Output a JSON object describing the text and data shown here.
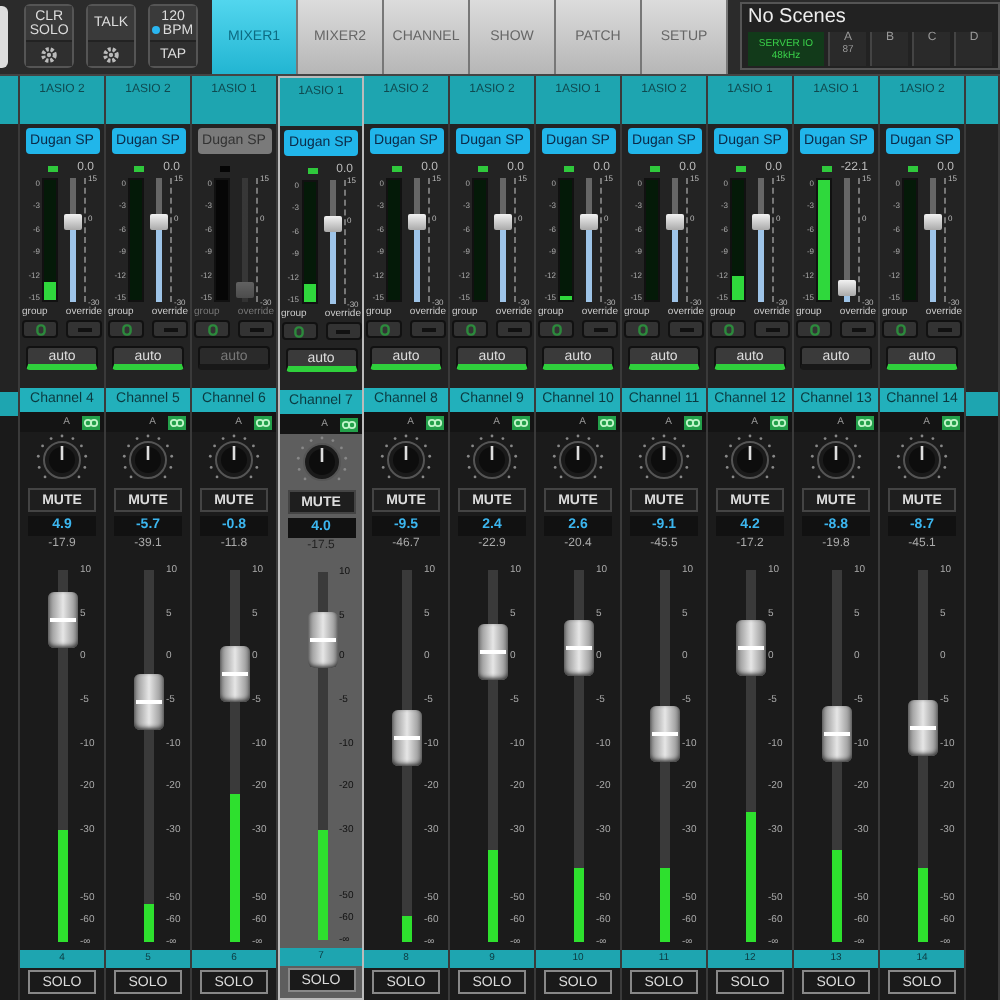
{
  "top_buttons": [
    {
      "kind": "gear",
      "label": "CLR SOLO"
    },
    {
      "kind": "gear",
      "label": "TALK"
    },
    {
      "kind": "tap",
      "tempo": "120",
      "unit": "BPM",
      "label": "TAP"
    }
  ],
  "tabs": [
    {
      "label": "MIXER1",
      "selected": true
    },
    {
      "label": "MIXER2",
      "selected": false
    },
    {
      "label": "CHANNEL",
      "selected": false
    },
    {
      "label": "SHOW",
      "selected": false
    },
    {
      "label": "PATCH",
      "selected": false
    },
    {
      "label": "SETUP",
      "selected": false
    }
  ],
  "scenes": {
    "title": "No Scenes",
    "server": "SERVER IO",
    "rate": "48kHz",
    "banks": [
      {
        "label": "A",
        "value": "87"
      },
      {
        "label": "B"
      },
      {
        "label": "C"
      },
      {
        "label": "D"
      }
    ]
  },
  "channels": [
    {
      "input": "1ASIO 2",
      "dugan": {
        "label": "Dugan SP",
        "enabled": true
      },
      "trim_reading": "0.0",
      "meter_scale": [
        "0",
        "-3",
        "-6",
        "-9",
        "-12",
        "-15"
      ],
      "meter": {
        "level": 0.15
      },
      "trim": {
        "level": 0.67
      },
      "trim_scale": [
        "15",
        "0",
        "-30"
      ],
      "group": "group",
      "override": "override",
      "auto": {
        "label": "auto",
        "on": true
      },
      "name": "Channel 4",
      "bus": "A",
      "mute": "MUTE",
      "gain": "4.9",
      "peak": "-17.9",
      "fader_scale": [
        "10",
        "5",
        "0",
        "-5",
        "-10",
        "-20",
        "-30",
        "-50",
        "-60",
        "-∞"
      ],
      "fader": {
        "level": 0.93
      },
      "fader_meter": {
        "level": 0.3
      },
      "number": "4",
      "solo": "SOLO",
      "selected": false
    },
    {
      "input": "1ASIO 2",
      "dugan": {
        "label": "Dugan SP",
        "enabled": true
      },
      "trim_reading": "0.0",
      "meter_scale": [
        "0",
        "-3",
        "-6",
        "-9",
        "-12",
        "-15"
      ],
      "trim": {
        "level": 0.67
      },
      "trim_scale": [
        "15",
        "0",
        "-30"
      ],
      "group": "group",
      "override": "override",
      "auto": {
        "label": "auto",
        "on": true
      },
      "name": "Channel 5",
      "bus": "A",
      "mute": "MUTE",
      "gain": "-5.7",
      "peak": "-39.1",
      "fader_scale": [
        "10",
        "5",
        "0",
        "-5",
        "-10",
        "-20",
        "-30",
        "-50",
        "-60",
        "-∞"
      ],
      "fader": {
        "level": 0.67
      },
      "fader_meter": {
        "level": 0.1
      },
      "number": "5",
      "solo": "SOLO",
      "selected": false
    },
    {
      "input": "1ASIO 1",
      "dugan": {
        "label": "Dugan SP",
        "enabled": false
      },
      "meter_scale": [
        "0",
        "-3",
        "-6",
        "-9",
        "-12",
        "-15"
      ],
      "trim": {
        "level": 0.03
      },
      "trim_scale": [
        "15",
        "0",
        "-30"
      ],
      "group": "group",
      "override": "override",
      "auto": {
        "label": "auto",
        "on": false
      },
      "name": "Channel 6",
      "bus": "A",
      "mute": "MUTE",
      "gain": "-0.8",
      "peak": "-11.8",
      "fader_scale": [
        "10",
        "5",
        "0",
        "-5",
        "-10",
        "-20",
        "-30",
        "-50",
        "-60",
        "-∞"
      ],
      "fader": {
        "level": 0.76
      },
      "fader_meter": {
        "level": 0.4
      },
      "number": "6",
      "solo": "SOLO",
      "selected": false
    },
    {
      "input": "1ASIO 1",
      "dugan": {
        "label": "Dugan SP",
        "enabled": true
      },
      "trim_reading": "0.0",
      "meter_scale": [
        "0",
        "-3",
        "-6",
        "-9",
        "-12",
        "-15"
      ],
      "meter": {
        "level": 0.15
      },
      "trim": {
        "level": 0.67
      },
      "trim_scale": [
        "15",
        "0",
        "-30"
      ],
      "group": "group",
      "override": "override",
      "auto": {
        "label": "auto",
        "on": true
      },
      "name": "Channel 7",
      "bus": "A",
      "mute": "MUTE",
      "gain": "4.0",
      "peak": "-17.5",
      "fader_scale": [
        "10",
        "5",
        "0",
        "-5",
        "-10",
        "-20",
        "-30",
        "-50",
        "-60",
        "-∞"
      ],
      "fader": {
        "level": 0.87
      },
      "fader_meter": {
        "level": 0.3
      },
      "number": "7",
      "solo": "SOLO",
      "selected": true
    },
    {
      "input": "1ASIO 2",
      "dugan": {
        "label": "Dugan SP",
        "enabled": true
      },
      "trim_reading": "0.0",
      "meter_scale": [
        "0",
        "-3",
        "-6",
        "-9",
        "-12",
        "-15"
      ],
      "trim": {
        "level": 0.67
      },
      "trim_scale": [
        "15",
        "0",
        "-30"
      ],
      "group": "group",
      "override": "override",
      "auto": {
        "label": "auto",
        "on": true
      },
      "name": "Channel 8",
      "bus": "A",
      "mute": "MUTE",
      "gain": "-9.5",
      "peak": "-46.7",
      "fader_scale": [
        "10",
        "5",
        "0",
        "-5",
        "-10",
        "-20",
        "-30",
        "-50",
        "-60",
        "-∞"
      ],
      "fader": {
        "level": 0.56
      },
      "fader_meter": {
        "level": 0.07
      },
      "number": "8",
      "solo": "SOLO",
      "selected": false
    },
    {
      "input": "1ASIO 2",
      "dugan": {
        "label": "Dugan SP",
        "enabled": true
      },
      "trim_reading": "0.0",
      "meter_scale": [
        "0",
        "-3",
        "-6",
        "-9",
        "-12",
        "-15"
      ],
      "trim": {
        "level": 0.67
      },
      "trim_scale": [
        "15",
        "0",
        "-30"
      ],
      "group": "group",
      "override": "override",
      "auto": {
        "label": "auto",
        "on": true
      },
      "name": "Channel 9",
      "bus": "A",
      "mute": "MUTE",
      "gain": "2.4",
      "peak": "-22.9",
      "fader_scale": [
        "10",
        "5",
        "0",
        "-5",
        "-10",
        "-20",
        "-30",
        "-50",
        "-60",
        "-∞"
      ],
      "fader": {
        "level": 0.83
      },
      "fader_meter": {
        "level": 0.25
      },
      "number": "9",
      "solo": "SOLO",
      "selected": false
    },
    {
      "input": "1ASIO 1",
      "dugan": {
        "label": "Dugan SP",
        "enabled": true
      },
      "trim_reading": "0.0",
      "meter_scale": [
        "0",
        "-3",
        "-6",
        "-9",
        "-12",
        "-15"
      ],
      "meter": {
        "level": 0.04
      },
      "trim": {
        "level": 0.67
      },
      "trim_scale": [
        "15",
        "0",
        "-30"
      ],
      "group": "group",
      "override": "override",
      "auto": {
        "label": "auto",
        "on": true
      },
      "name": "Channel 10",
      "bus": "A",
      "mute": "MUTE",
      "gain": "2.6",
      "peak": "-20.4",
      "fader_scale": [
        "10",
        "5",
        "0",
        "-5",
        "-10",
        "-20",
        "-30",
        "-50",
        "-60",
        "-∞"
      ],
      "fader": {
        "level": 0.84
      },
      "fader_meter": {
        "level": 0.2
      },
      "number": "10",
      "solo": "SOLO",
      "selected": false
    },
    {
      "input": "1ASIO 2",
      "dugan": {
        "label": "Dugan SP",
        "enabled": true
      },
      "trim_reading": "0.0",
      "meter_scale": [
        "0",
        "-3",
        "-6",
        "-9",
        "-12",
        "-15"
      ],
      "trim": {
        "level": 0.67
      },
      "trim_scale": [
        "15",
        "0",
        "-30"
      ],
      "group": "group",
      "override": "override",
      "auto": {
        "label": "auto",
        "on": true
      },
      "name": "Channel 11",
      "bus": "A",
      "mute": "MUTE",
      "gain": "-9.1",
      "peak": "-45.5",
      "fader_scale": [
        "10",
        "5",
        "0",
        "-5",
        "-10",
        "-20",
        "-30",
        "-50",
        "-60",
        "-∞"
      ],
      "fader": {
        "level": 0.57
      },
      "fader_meter": {
        "level": 0.2
      },
      "number": "11",
      "solo": "SOLO",
      "selected": false
    },
    {
      "input": "1ASIO 1",
      "dugan": {
        "label": "Dugan SP",
        "enabled": true
      },
      "trim_reading": "0.0",
      "meter_scale": [
        "0",
        "-3",
        "-6",
        "-9",
        "-12",
        "-15"
      ],
      "meter": {
        "level": 0.2
      },
      "trim": {
        "level": 0.67
      },
      "trim_scale": [
        "15",
        "0",
        "-30"
      ],
      "group": "group",
      "override": "override",
      "auto": {
        "label": "auto",
        "on": true
      },
      "name": "Channel 12",
      "bus": "A",
      "mute": "MUTE",
      "gain": "4.2",
      "peak": "-17.2",
      "fader_scale": [
        "10",
        "5",
        "0",
        "-5",
        "-10",
        "-20",
        "-30",
        "-50",
        "-60",
        "-∞"
      ],
      "fader": {
        "level": 0.84
      },
      "fader_meter": {
        "level": 0.35
      },
      "number": "12",
      "solo": "SOLO",
      "selected": false
    },
    {
      "input": "1ASIO 1",
      "dugan": {
        "label": "Dugan SP",
        "enabled": true
      },
      "trim_reading": "-22.1",
      "meter_scale": [
        "0",
        "-3",
        "-6",
        "-9",
        "-12",
        "-15"
      ],
      "meter": {
        "level": 1
      },
      "trim": {
        "level": 0.05
      },
      "trim_scale": [
        "15",
        "0",
        "-30"
      ],
      "group": "group",
      "override": "override",
      "auto": {
        "label": "auto",
        "on": false
      },
      "name": "Channel 13",
      "bus": "A",
      "mute": "MUTE",
      "gain": "-8.8",
      "peak": "-19.8",
      "fader_scale": [
        "10",
        "5",
        "0",
        "-5",
        "-10",
        "-20",
        "-30",
        "-50",
        "-60",
        "-∞"
      ],
      "fader": {
        "level": 0.57
      },
      "fader_meter": {
        "level": 0.25
      },
      "number": "13",
      "solo": "SOLO",
      "selected": false
    },
    {
      "input": "1ASIO 2",
      "dugan": {
        "label": "Dugan SP",
        "enabled": true
      },
      "trim_reading": "0.0",
      "meter_scale": [
        "0",
        "-3",
        "-6",
        "-9",
        "-12",
        "-15"
      ],
      "trim": {
        "level": 0.67
      },
      "trim_scale": [
        "15",
        "0",
        "-30"
      ],
      "group": "group",
      "override": "override",
      "auto": {
        "label": "auto",
        "on": true
      },
      "name": "Channel 14",
      "bus": "A",
      "mute": "MUTE",
      "gain": "-8.7",
      "peak": "-45.1",
      "fader_scale": [
        "10",
        "5",
        "0",
        "-5",
        "-10",
        "-20",
        "-30",
        "-50",
        "-60",
        "-∞"
      ],
      "fader": {
        "level": 0.59
      },
      "fader_meter": {
        "level": 0.2
      },
      "number": "14",
      "solo": "SOLO",
      "selected": false
    }
  ]
}
